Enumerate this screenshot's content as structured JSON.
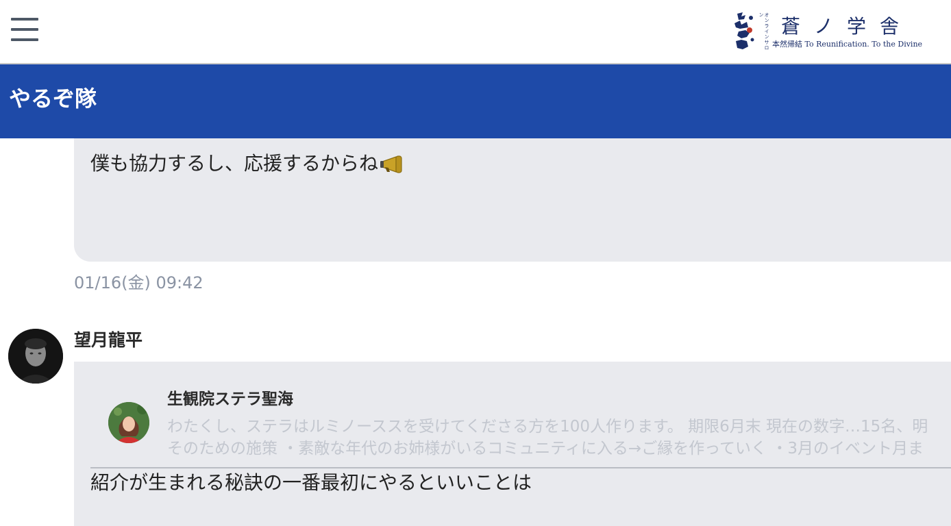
{
  "header": {
    "menu_icon": "hamburger-menu-icon",
    "logo": {
      "title": "蒼ノ学舎",
      "vertical_caption": "オンラインサロン",
      "subtitle": "本然帰結 To Reunification. To the Divine",
      "color": "#1c2f6a"
    }
  },
  "group": {
    "title": "やるぞ隊",
    "color": "#1e4aa8"
  },
  "messages": [
    {
      "text": "僕も協力するし、応援するからね",
      "emoji": "megaphone-icon",
      "timestamp": "01/16(金) 09:42"
    },
    {
      "sender": "望月龍平",
      "quote": {
        "name": "生観院ステラ聖海",
        "line1": "わたくし、ステラはルミノーススを受けてくださる方を100人作ります。 期限6月末 現在の数字…15名、明",
        "line2": "そのための施策 ・素敵な年代のお姉様がいるコミュニティに入る→ご縁を作っていく ・3月のイベント月ま"
      },
      "text": "紹介が生まれる秘訣の一番最初にやるといいことは"
    }
  ]
}
